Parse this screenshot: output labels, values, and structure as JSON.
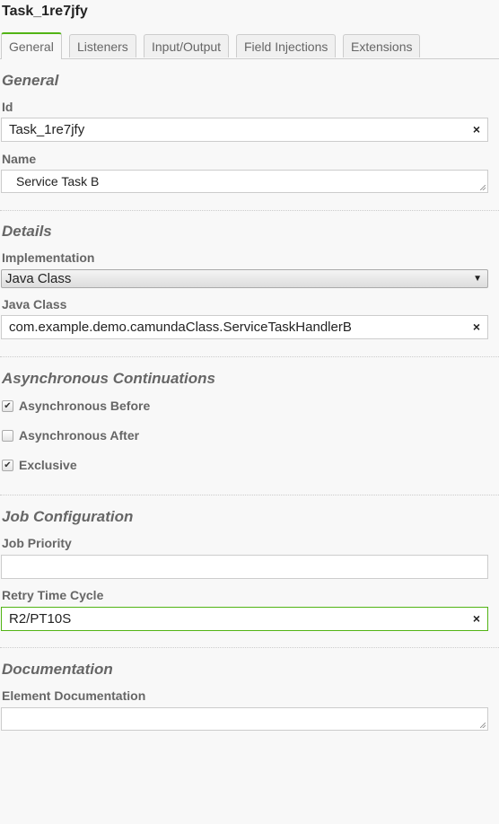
{
  "header": {
    "title": "Task_1re7jfy"
  },
  "tabs": [
    {
      "label": "General",
      "active": true
    },
    {
      "label": "Listeners"
    },
    {
      "label": "Input/Output"
    },
    {
      "label": "Field Injections"
    },
    {
      "label": "Extensions"
    }
  ],
  "accent_color": "#52b415",
  "general": {
    "heading": "General",
    "id_label": "Id",
    "id_value": "Task_1re7jfy",
    "name_label": "Name",
    "name_value": "Service Task B"
  },
  "details": {
    "heading": "Details",
    "implementation_label": "Implementation",
    "implementation_value": "Java Class",
    "java_class_label": "Java Class",
    "java_class_value": "com.example.demo.camundaClass.ServiceTaskHandlerB"
  },
  "async": {
    "heading": "Asynchronous Continuations",
    "items": [
      {
        "label": "Asynchronous Before",
        "checked": true
      },
      {
        "label": "Asynchronous After",
        "checked": false
      },
      {
        "label": "Exclusive",
        "checked": true
      }
    ]
  },
  "job": {
    "heading": "Job Configuration",
    "priority_label": "Job Priority",
    "priority_value": "",
    "retry_label": "Retry Time Cycle",
    "retry_value": "R2/PT10S"
  },
  "documentation": {
    "heading": "Documentation",
    "element_label": "Element Documentation",
    "element_value": ""
  },
  "icons": {
    "clear": "×",
    "dropdown": "▼",
    "check": "✔"
  }
}
